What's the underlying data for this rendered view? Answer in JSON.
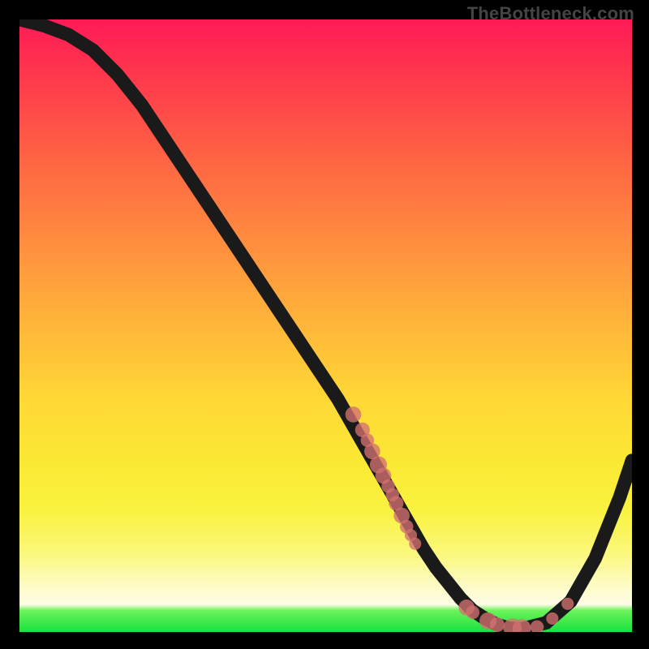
{
  "watermark": "TheBottleneck.com",
  "chart_data": {
    "type": "line",
    "title": "",
    "xlabel": "",
    "ylabel": "",
    "xlim": [
      0,
      100
    ],
    "ylim": [
      0,
      100
    ],
    "grid": false,
    "legend": false,
    "series": [
      {
        "name": "curve",
        "x": [
          0,
          4,
          8,
          12,
          16,
          20,
          24,
          28,
          32,
          36,
          40,
          44,
          48,
          52,
          56,
          58,
          60,
          62,
          64,
          66,
          68,
          70,
          72,
          74,
          76,
          78,
          80,
          82,
          86,
          90,
          94,
          98,
          100
        ],
        "y": [
          100,
          99,
          97.5,
          95,
          91,
          86,
          80,
          74,
          68,
          62,
          56,
          50,
          44,
          38,
          31,
          27.5,
          24,
          20.5,
          17,
          13.5,
          10.5,
          8,
          5.5,
          3.5,
          2.2,
          1.2,
          0.6,
          0.5,
          1.5,
          5,
          12,
          22,
          28
        ]
      }
    ],
    "markers": [
      {
        "x": 54.5,
        "y": 35.5,
        "r": 1.3
      },
      {
        "x": 56.0,
        "y": 33.0,
        "r": 1.2
      },
      {
        "x": 56.8,
        "y": 31.3,
        "r": 1.1
      },
      {
        "x": 57.6,
        "y": 29.5,
        "r": 1.3
      },
      {
        "x": 58.6,
        "y": 27.3,
        "r": 1.4
      },
      {
        "x": 59.4,
        "y": 25.5,
        "r": 1.3
      },
      {
        "x": 60.2,
        "y": 23.8,
        "r": 1.1
      },
      {
        "x": 60.9,
        "y": 22.4,
        "r": 1.1
      },
      {
        "x": 61.5,
        "y": 21.0,
        "r": 1.2
      },
      {
        "x": 62.4,
        "y": 19.0,
        "r": 1.3
      },
      {
        "x": 63.2,
        "y": 17.2,
        "r": 1.1
      },
      {
        "x": 63.9,
        "y": 15.8,
        "r": 1.0
      },
      {
        "x": 64.6,
        "y": 14.4,
        "r": 1.0
      },
      {
        "x": 73.0,
        "y": 4.0,
        "r": 1.3
      },
      {
        "x": 74.0,
        "y": 3.2,
        "r": 1.1
      },
      {
        "x": 76.5,
        "y": 1.8,
        "r": 1.4
      },
      {
        "x": 78.0,
        "y": 1.2,
        "r": 1.2
      },
      {
        "x": 80.5,
        "y": 0.7,
        "r": 1.5
      },
      {
        "x": 82.0,
        "y": 0.6,
        "r": 1.5
      },
      {
        "x": 84.5,
        "y": 0.8,
        "r": 1.1
      },
      {
        "x": 87.0,
        "y": 2.2,
        "r": 1.0
      },
      {
        "x": 89.5,
        "y": 4.6,
        "r": 1.0
      }
    ],
    "background_gradient": {
      "type": "linear-vertical",
      "stops": [
        {
          "offset": 0.0,
          "color": "#ff1a56"
        },
        {
          "offset": 0.1,
          "color": "#ff3a4c"
        },
        {
          "offset": 0.24,
          "color": "#ff6843"
        },
        {
          "offset": 0.36,
          "color": "#ff8c3f"
        },
        {
          "offset": 0.5,
          "color": "#ffb63a"
        },
        {
          "offset": 0.62,
          "color": "#ffd836"
        },
        {
          "offset": 0.72,
          "color": "#fbe833"
        },
        {
          "offset": 0.8,
          "color": "#f9f23e"
        },
        {
          "offset": 0.87,
          "color": "#fbf87a"
        },
        {
          "offset": 0.92,
          "color": "#fdfbc0"
        },
        {
          "offset": 0.955,
          "color": "#fffde6"
        },
        {
          "offset": 0.965,
          "color": "#6bf25a"
        },
        {
          "offset": 1.0,
          "color": "#18e23e"
        }
      ]
    }
  }
}
